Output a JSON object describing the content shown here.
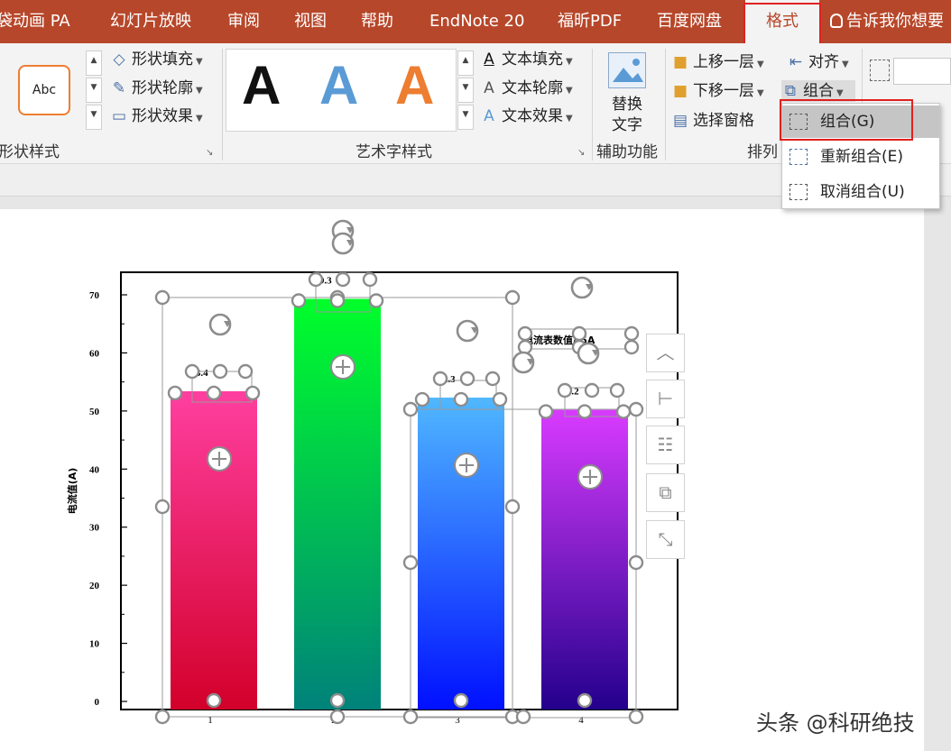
{
  "tabs": [
    {
      "label": "袋动画 PA",
      "active": false
    },
    {
      "label": "幻灯片放映",
      "active": false
    },
    {
      "label": "审阅",
      "active": false
    },
    {
      "label": "视图",
      "active": false
    },
    {
      "label": "帮助",
      "active": false
    },
    {
      "label": "EndNote 20",
      "active": false
    },
    {
      "label": "福昕PDF",
      "active": false
    },
    {
      "label": "百度网盘",
      "active": false
    },
    {
      "label": "格式",
      "active": true
    }
  ],
  "tell_me": "告诉我你想要",
  "ribbon": {
    "shape_styles": {
      "preview": "Abc",
      "fill": "形状填充",
      "outline": "形状轮廓",
      "effects": "形状效果",
      "group_label": "形状样式"
    },
    "wordart": {
      "letters": [
        "A",
        "A",
        "A"
      ],
      "colors": [
        "#111111",
        "#5b9bd5",
        "#ed7d31"
      ],
      "text_fill": "文本填充",
      "text_outline": "文本轮廓",
      "text_effects": "文本效果",
      "group_label": "艺术字样式"
    },
    "accessibility": {
      "alt_text_line1": "替换",
      "alt_text_line2": "文字",
      "group_label": "辅助功能"
    },
    "arrange": {
      "bring_forward": "上移一层",
      "send_backward": "下移一层",
      "selection_pane": "选择窗格",
      "align": "对齐",
      "group": "组合",
      "group_label": "排列"
    }
  },
  "dropdown": {
    "items": [
      {
        "label": "组合(G)",
        "highlighted": true
      },
      {
        "label": "重新组合(E)",
        "highlighted": false
      },
      {
        "label": "取消组合(U)",
        "highlighted": false
      }
    ]
  },
  "side_toolbar": [
    "chevron-up-icon",
    "align-left-icon",
    "distribute-icon",
    "bring-front-icon",
    "resize-icon"
  ],
  "chart_data": {
    "type": "bar",
    "categories": [
      "1",
      "2",
      "3",
      "4"
    ],
    "values": [
      53.4,
      69.3,
      52.3,
      50.2
    ],
    "value_labels": [
      "53.4",
      "69.3",
      "52.3",
      "50.2"
    ],
    "ylabel": "电流值(A)",
    "ylim": [
      0,
      70
    ],
    "yticks": [
      "0",
      "10",
      "20",
      "30",
      "40",
      "50",
      "60",
      "70"
    ],
    "annotation": "电流表数值/.5A",
    "gradients": [
      [
        "#ff3fa0",
        "#d2002a"
      ],
      [
        "#00ff2a",
        "#00827a"
      ],
      [
        "#50b8ff",
        "#0010ff"
      ],
      [
        "#d93bff",
        "#24008c"
      ]
    ]
  },
  "watermark": "头条 @科研绝技"
}
